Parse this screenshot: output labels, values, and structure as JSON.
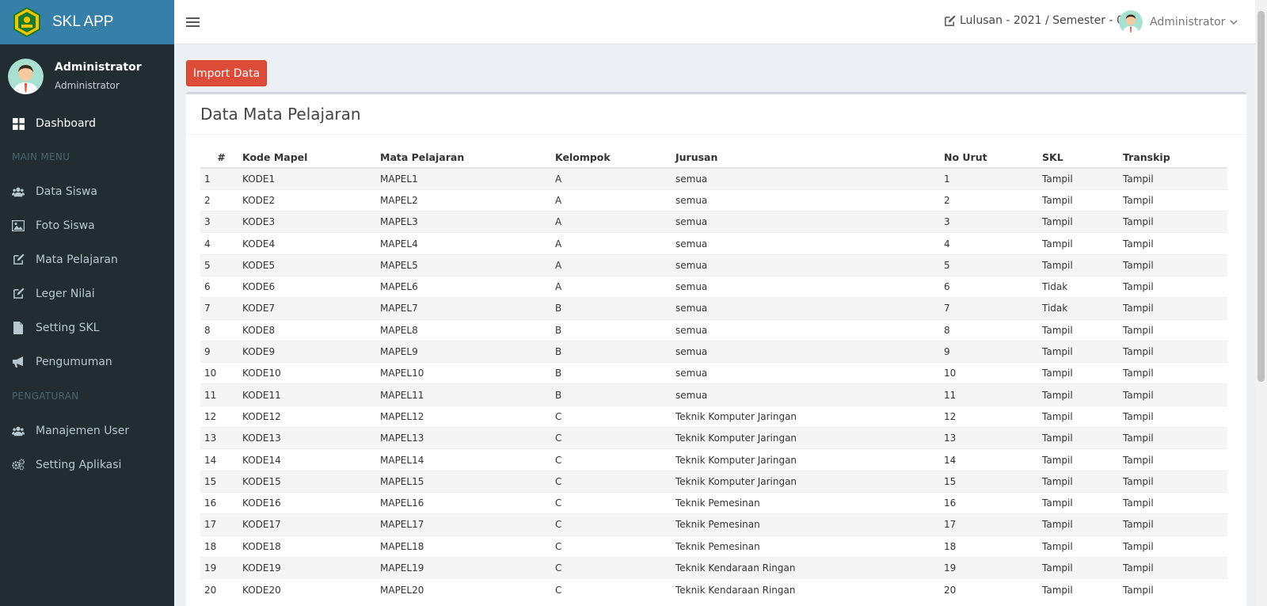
{
  "brand": {
    "name": "SKL APP",
    "logo_icon": "school-emblem-logo"
  },
  "user_panel": {
    "name": "Administrator",
    "role": "Administrator"
  },
  "sidebar": {
    "dashboard": {
      "label": "Dashboard",
      "icon": "dashboard-icon"
    },
    "main_menu_header": "MAIN MENU",
    "main_menu": [
      {
        "label": "Data Siswa",
        "icon": "users-icon"
      },
      {
        "label": "Foto Siswa",
        "icon": "image-icon"
      },
      {
        "label": "Mata Pelajaran",
        "icon": "edit-icon"
      },
      {
        "label": "Leger Nilai",
        "icon": "edit-icon"
      },
      {
        "label": "Setting SKL",
        "icon": "file-icon"
      },
      {
        "label": "Pengumuman",
        "icon": "bullhorn-icon"
      }
    ],
    "settings_header": "PENGATURAN",
    "settings_menu": [
      {
        "label": "Manajemen User",
        "icon": "users-icon"
      },
      {
        "label": "Setting Aplikasi",
        "icon": "gears-icon"
      }
    ]
  },
  "header": {
    "period": "Lulusan - 2021 / Semester - 0",
    "user": "Administrator"
  },
  "content": {
    "import_button": "Import Data",
    "box_title": "Data Mata Pelajaran",
    "table": {
      "headers": [
        "#",
        "Kode Mapel",
        "Mata Pelajaran",
        "Kelompok",
        "Jurusan",
        "No Urut",
        "SKL",
        "Transkip"
      ],
      "rows": [
        [
          "1",
          "KODE1",
          "MAPEL1",
          "A",
          "semua",
          "1",
          "Tampil",
          "Tampil"
        ],
        [
          "2",
          "KODE2",
          "MAPEL2",
          "A",
          "semua",
          "2",
          "Tampil",
          "Tampil"
        ],
        [
          "3",
          "KODE3",
          "MAPEL3",
          "A",
          "semua",
          "3",
          "Tampil",
          "Tampil"
        ],
        [
          "4",
          "KODE4",
          "MAPEL4",
          "A",
          "semua",
          "4",
          "Tampil",
          "Tampil"
        ],
        [
          "5",
          "KODE5",
          "MAPEL5",
          "A",
          "semua",
          "5",
          "Tampil",
          "Tampil"
        ],
        [
          "6",
          "KODE6",
          "MAPEL6",
          "A",
          "semua",
          "6",
          "Tidak",
          "Tampil"
        ],
        [
          "7",
          "KODE7",
          "MAPEL7",
          "B",
          "semua",
          "7",
          "Tidak",
          "Tampil"
        ],
        [
          "8",
          "KODE8",
          "MAPEL8",
          "B",
          "semua",
          "8",
          "Tampil",
          "Tampil"
        ],
        [
          "9",
          "KODE9",
          "MAPEL9",
          "B",
          "semua",
          "9",
          "Tampil",
          "Tampil"
        ],
        [
          "10",
          "KODE10",
          "MAPEL10",
          "B",
          "semua",
          "10",
          "Tampil",
          "Tampil"
        ],
        [
          "11",
          "KODE11",
          "MAPEL11",
          "B",
          "semua",
          "11",
          "Tampil",
          "Tampil"
        ],
        [
          "12",
          "KODE12",
          "MAPEL12",
          "C",
          "Teknik Komputer Jaringan",
          "12",
          "Tampil",
          "Tampil"
        ],
        [
          "13",
          "KODE13",
          "MAPEL13",
          "C",
          "Teknik Komputer Jaringan",
          "13",
          "Tampil",
          "Tampil"
        ],
        [
          "14",
          "KODE14",
          "MAPEL14",
          "C",
          "Teknik Komputer Jaringan",
          "14",
          "Tampil",
          "Tampil"
        ],
        [
          "15",
          "KODE15",
          "MAPEL15",
          "C",
          "Teknik Komputer Jaringan",
          "15",
          "Tampil",
          "Tampil"
        ],
        [
          "16",
          "KODE16",
          "MAPEL16",
          "C",
          "Teknik Pemesinan",
          "16",
          "Tampil",
          "Tampil"
        ],
        [
          "17",
          "KODE17",
          "MAPEL17",
          "C",
          "Teknik Pemesinan",
          "17",
          "Tampil",
          "Tampil"
        ],
        [
          "18",
          "KODE18",
          "MAPEL18",
          "C",
          "Teknik Pemesinan",
          "18",
          "Tampil",
          "Tampil"
        ],
        [
          "19",
          "KODE19",
          "MAPEL19",
          "C",
          "Teknik Kendaraan Ringan",
          "19",
          "Tampil",
          "Tampil"
        ],
        [
          "20",
          "KODE20",
          "MAPEL20",
          "C",
          "Teknik Kendaraan Ringan",
          "20",
          "Tampil",
          "Tampil"
        ]
      ]
    }
  },
  "colors": {
    "sidebar_bg": "#222d32",
    "brand_bg": "#367fa9",
    "import_button": "#dd4b39",
    "body_bg": "#ecf0f5"
  }
}
